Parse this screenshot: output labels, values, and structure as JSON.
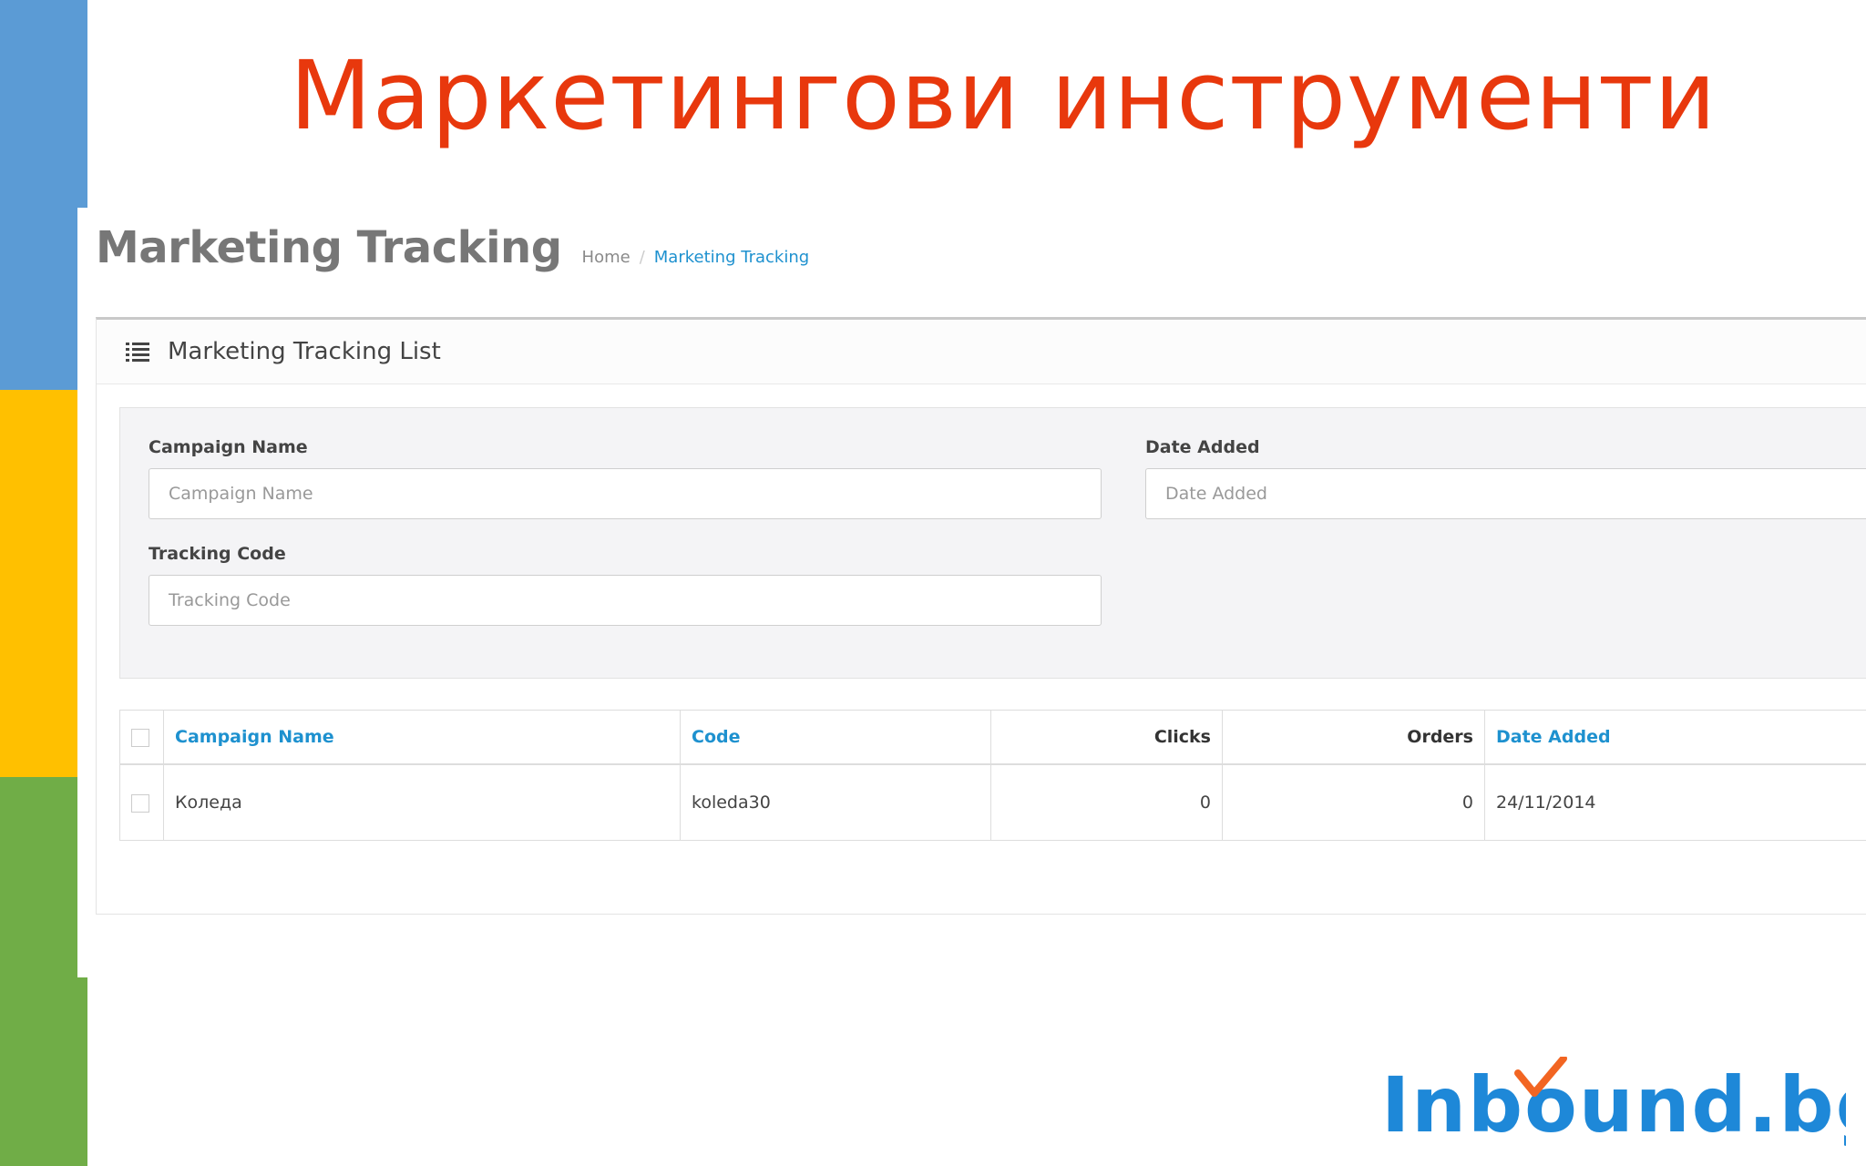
{
  "slide": {
    "title": "Маркетингови инструменти"
  },
  "page": {
    "title": "Marketing Tracking",
    "breadcrumb": {
      "home": "Home",
      "separator": "/",
      "current": "Marketing Tracking"
    }
  },
  "panel": {
    "title": "Marketing Tracking List",
    "icon": "list-icon"
  },
  "filter": {
    "campaign_name": {
      "label": "Campaign Name",
      "placeholder": "Campaign Name"
    },
    "date_added": {
      "label": "Date Added",
      "placeholder": "Date Added"
    },
    "tracking_code": {
      "label": "Tracking Code",
      "placeholder": "Tracking Code"
    }
  },
  "table": {
    "headers": {
      "campaign_name": "Campaign Name",
      "code": "Code",
      "clicks": "Clicks",
      "orders": "Orders",
      "date_added": "Date Added"
    },
    "rows": [
      {
        "campaign_name": "Коледа",
        "code": "koleda30",
        "clicks": "0",
        "orders": "0",
        "date_added": "24/11/2014"
      }
    ]
  },
  "logo": {
    "text": "Inbound.bg"
  },
  "colors": {
    "title": "#e8380d",
    "link": "#1e91cf",
    "strip_blue": "#5b9bd5",
    "strip_yellow": "#ffc000",
    "strip_green": "#70ad47",
    "logo_blue": "#1e88d8",
    "logo_orange": "#f26522"
  }
}
